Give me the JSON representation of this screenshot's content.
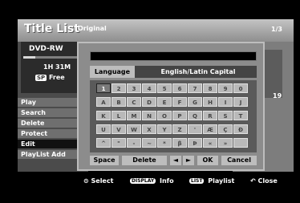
{
  "header": {
    "title": "Title List",
    "subtitle": "Original",
    "page": "1/3"
  },
  "disc": {
    "name": "DVD-RW",
    "time": "1H 31M",
    "mode": "SP",
    "free_label": "Free"
  },
  "menu": {
    "items": [
      {
        "label": "Play"
      },
      {
        "label": "Search"
      },
      {
        "label": "Delete"
      },
      {
        "label": "Protect"
      },
      {
        "label": "Edit"
      },
      {
        "label": "PlayList Add"
      }
    ],
    "selected": "Edit"
  },
  "thumbnail": {
    "number": "19"
  },
  "dialog": {
    "input_value": "",
    "language_label": "Language",
    "language_value": "English/Latin Capital",
    "keys": [
      [
        "1",
        "2",
        "3",
        "4",
        "5",
        "6",
        "7",
        "8",
        "9",
        "0"
      ],
      [
        "A",
        "B",
        "C",
        "D",
        "E",
        "F",
        "G",
        "H",
        "I",
        "J"
      ],
      [
        "K",
        "L",
        "M",
        "N",
        "O",
        "P",
        "Q",
        "R",
        "S",
        "T"
      ],
      [
        "U",
        "V",
        "W",
        "X",
        "Y",
        "Z",
        "'",
        "Æ",
        "Ç",
        "Đ"
      ],
      [
        "^",
        "\"",
        "-",
        "~",
        "*",
        "β",
        "Þ",
        "«",
        "»",
        ""
      ]
    ],
    "focused_key": "1",
    "actions": {
      "space": "Space",
      "delete": "Delete",
      "left": "◄",
      "right": "►",
      "ok": "OK",
      "cancel": "Cancel"
    }
  },
  "bottom": {
    "select": "Select",
    "display_btn": "DISPLAY",
    "info": "Info",
    "list_btn": "LIST",
    "playlist": "Playlist",
    "close_icon": "return-arrow-icon",
    "close": "Close"
  },
  "colors": {
    "background": "#000000",
    "panel": "#8c8c8c",
    "key": "#b9b9b9",
    "selected": "#111111"
  }
}
